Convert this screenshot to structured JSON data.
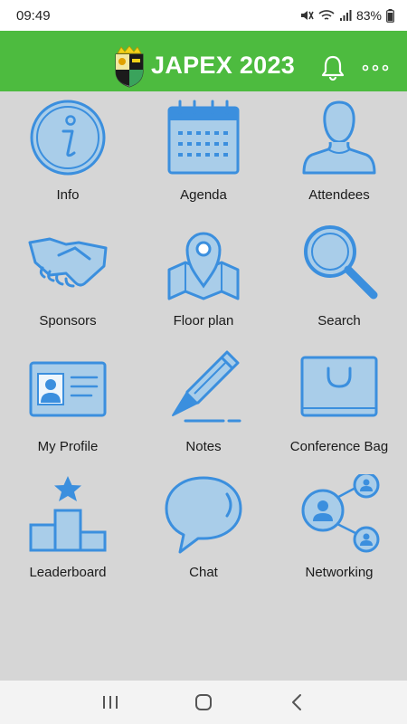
{
  "status_bar": {
    "time": "09:49",
    "battery": "83%"
  },
  "app_bar": {
    "title": "JAPEX 2023",
    "notification_icon": "bell-icon",
    "menu_icon": "more-horizontal-icon"
  },
  "tiles": [
    {
      "label": "Info",
      "icon": "info-icon"
    },
    {
      "label": "Agenda",
      "icon": "calendar-icon"
    },
    {
      "label": "Attendees",
      "icon": "person-icon"
    },
    {
      "label": "Sponsors",
      "icon": "handshake-icon"
    },
    {
      "label": "Floor plan",
      "icon": "map-pin-icon"
    },
    {
      "label": "Search",
      "icon": "magnifier-icon"
    },
    {
      "label": "My Profile",
      "icon": "id-card-icon"
    },
    {
      "label": "Notes",
      "icon": "pen-icon"
    },
    {
      "label": "Conference Bag",
      "icon": "bag-icon"
    },
    {
      "label": "Leaderboard",
      "icon": "podium-icon"
    },
    {
      "label": "Chat",
      "icon": "speech-bubble-icon"
    },
    {
      "label": "Networking",
      "icon": "network-icon"
    }
  ],
  "colors": {
    "app_bar": "#4dbb3f",
    "icon_stroke": "#3b8fde",
    "icon_fill": "#a9cde9",
    "background": "#d6d6d6"
  },
  "nav_bar": {
    "recents_icon": "recents-icon",
    "home_icon": "home-icon",
    "back_icon": "back-icon"
  }
}
